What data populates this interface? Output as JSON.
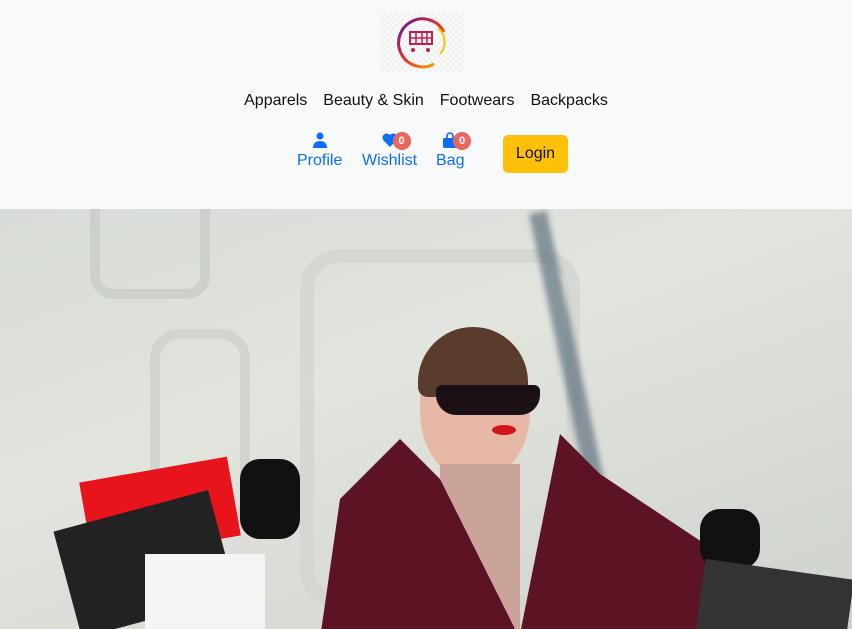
{
  "header": {
    "logo_alt": "shopping cart logo"
  },
  "nav": {
    "items": [
      {
        "label": "Apparels"
      },
      {
        "label": "Beauty & Skin"
      },
      {
        "label": "Footwears"
      },
      {
        "label": "Backpacks"
      }
    ]
  },
  "actions": {
    "profile": {
      "label": "Profile"
    },
    "wishlist": {
      "label": "Wishlist",
      "count": "0"
    },
    "bag": {
      "label": "Bag",
      "count": "0"
    },
    "login": "Login"
  },
  "colors": {
    "accent": "#0d6efd",
    "login": "#ffc107",
    "badge": "#e8675f"
  }
}
